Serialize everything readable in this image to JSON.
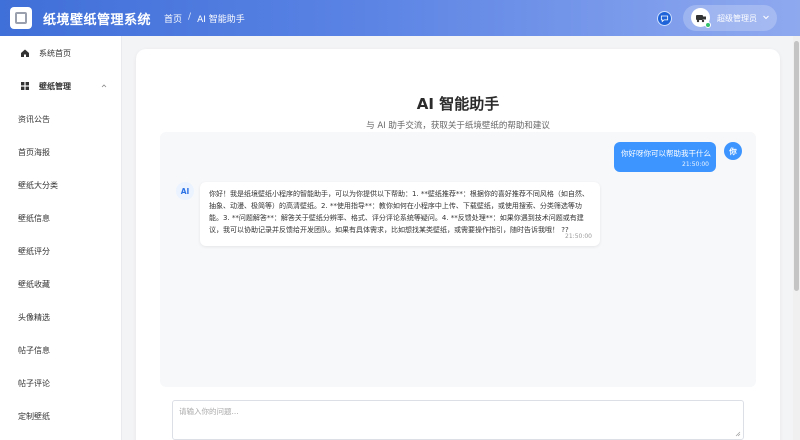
{
  "header": {
    "app_title": "纸境壁纸管理系统",
    "breadcrumb": [
      "首页",
      "AI 智能助手"
    ],
    "breadcrumb_separator": "/",
    "user_name": "超级管理员",
    "icons": {
      "messages": "chat-bubble-icon",
      "user_menu": "chevron-down-icon"
    }
  },
  "sidebar": {
    "items": [
      {
        "label": "系统首页",
        "icon": "home-icon"
      },
      {
        "label": "壁纸管理",
        "icon": "grid-icon",
        "expanded": true
      },
      {
        "label": "资讯公告"
      },
      {
        "label": "首页海报"
      },
      {
        "label": "壁纸大分类"
      },
      {
        "label": "壁纸信息"
      },
      {
        "label": "壁纸评分"
      },
      {
        "label": "壁纸收藏"
      },
      {
        "label": "头像精选"
      },
      {
        "label": "帖子信息"
      },
      {
        "label": "帖子评论"
      },
      {
        "label": "定制壁纸"
      }
    ]
  },
  "main": {
    "title": "AI 智能助手",
    "subtitle": "与 AI 助手交流，获取关于纸境壁纸的帮助和建议",
    "messages": [
      {
        "role": "user",
        "avatar": "你",
        "text": "你好呀你可以帮助我干什么",
        "time": "21:50:00"
      },
      {
        "role": "ai",
        "avatar": "AI",
        "text": "你好！我是纸境壁纸小程序的智能助手，可以为你提供以下帮助：1. **壁纸推荐**：根据你的喜好推荐不同风格（如自然、抽象、动漫、极简等）的高清壁纸。2. **使用指导**：教你如何在小程序中上传、下载壁纸，或使用搜索、分类筛选等功能。3. **问题解答**：解答关于壁纸分辨率、格式、评分评论系统等疑问。4. **反馈处理**：如果你遇到技术问题或有建议，我可以协助记录并反馈给开发团队。如果有具体需求，比如想找某类壁纸，或需要操作指引，随时告诉我哦！ ??",
        "time": "21:50:00"
      }
    ],
    "input_placeholder": "请输入你的问题...",
    "accent_color": "#3d95ff"
  }
}
